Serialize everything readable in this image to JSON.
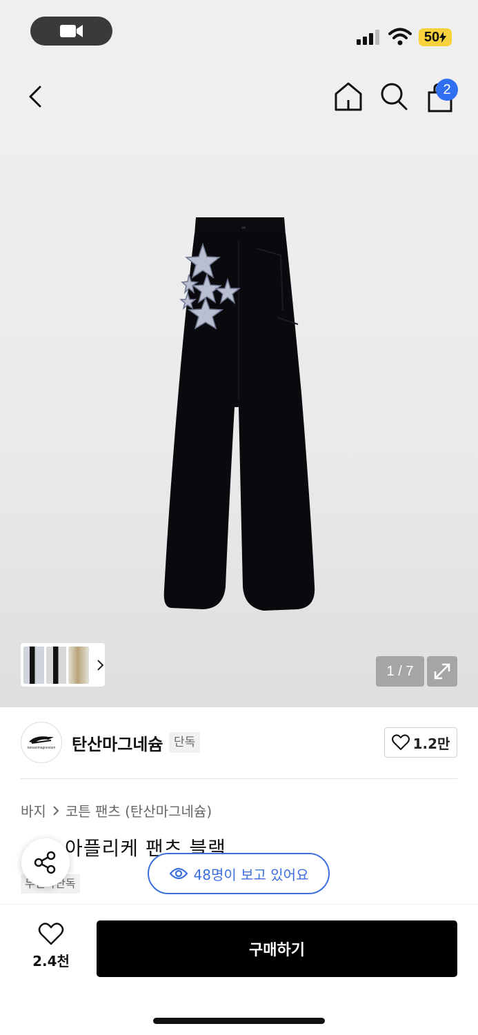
{
  "status_bar": {
    "battery": "50"
  },
  "nav": {
    "cart_count": "2"
  },
  "gallery": {
    "counter": "1 / 7"
  },
  "brand": {
    "name": "탄산마그네슘",
    "tag": "단독",
    "logo_text": "tansanmagnesium",
    "likes": "1.2만"
  },
  "breadcrumb": {
    "category": "바지",
    "subcategory": "코튼 팬츠 (탄산마그네슘)"
  },
  "product": {
    "title": "아플리케 팬츠 블랙",
    "badge": "무신사단독"
  },
  "viewers": {
    "text": "48명이 보고 있어요"
  },
  "bottom_bar": {
    "wish_count": "2.4천",
    "buy_label": "구매하기"
  },
  "colors": {
    "accent": "#2f6ff0",
    "battery": "#f8d23c"
  }
}
